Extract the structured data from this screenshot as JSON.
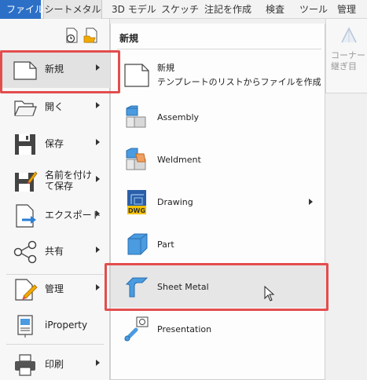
{
  "ribbon": {
    "tabs": [
      {
        "label": "ファイル"
      },
      {
        "label": "シートメタル"
      },
      {
        "label": "3D モデル"
      },
      {
        "label": "スケッチ"
      },
      {
        "label": "注記を作成"
      },
      {
        "label": "検査"
      },
      {
        "label": "ツール"
      },
      {
        "label": "管理"
      }
    ],
    "remnant_label": "コーナー継ぎ目"
  },
  "file_menu": {
    "items": [
      {
        "label": "新規",
        "icon": "new-document-icon",
        "has_submenu": true,
        "selected": true
      },
      {
        "label": "開く",
        "icon": "open-folder-icon",
        "has_submenu": true
      },
      {
        "label": "保存",
        "icon": "save-floppy-icon",
        "has_submenu": true
      },
      {
        "label": "名前を付けて保存",
        "line1": "名前を付け",
        "line2": "て保存",
        "icon": "save-as-icon",
        "has_submenu": true
      },
      {
        "label": "エクスポート",
        "icon": "export-icon",
        "has_submenu": true
      },
      {
        "label": "共有",
        "icon": "share-icon",
        "has_submenu": true
      },
      {
        "label": "管理",
        "icon": "manage-icon",
        "has_submenu": true
      },
      {
        "label": "iProperty",
        "icon": "iproperty-icon",
        "has_submenu": false
      },
      {
        "label": "印刷",
        "icon": "printer-icon",
        "has_submenu": true
      }
    ]
  },
  "submenu": {
    "title": "新規",
    "items": [
      {
        "label": "新規",
        "sublabel": "テンプレートのリストからファイルを作成",
        "icon": "blank-document-icon"
      },
      {
        "label": "Assembly",
        "icon": "assembly-icon"
      },
      {
        "label": "Weldment",
        "icon": "weldment-icon"
      },
      {
        "label": "Drawing",
        "icon": "drawing-dwg-icon",
        "has_submenu": true
      },
      {
        "label": "Part",
        "icon": "part-cube-icon"
      },
      {
        "label": "Sheet Metal",
        "icon": "sheet-metal-icon",
        "hover": true
      },
      {
        "label": "Presentation",
        "icon": "presentation-icon"
      }
    ]
  },
  "colors": {
    "file_tab": "#2b6fc7",
    "highlight_red": "#e34d4d",
    "icon_blue": "#4a9be0"
  }
}
